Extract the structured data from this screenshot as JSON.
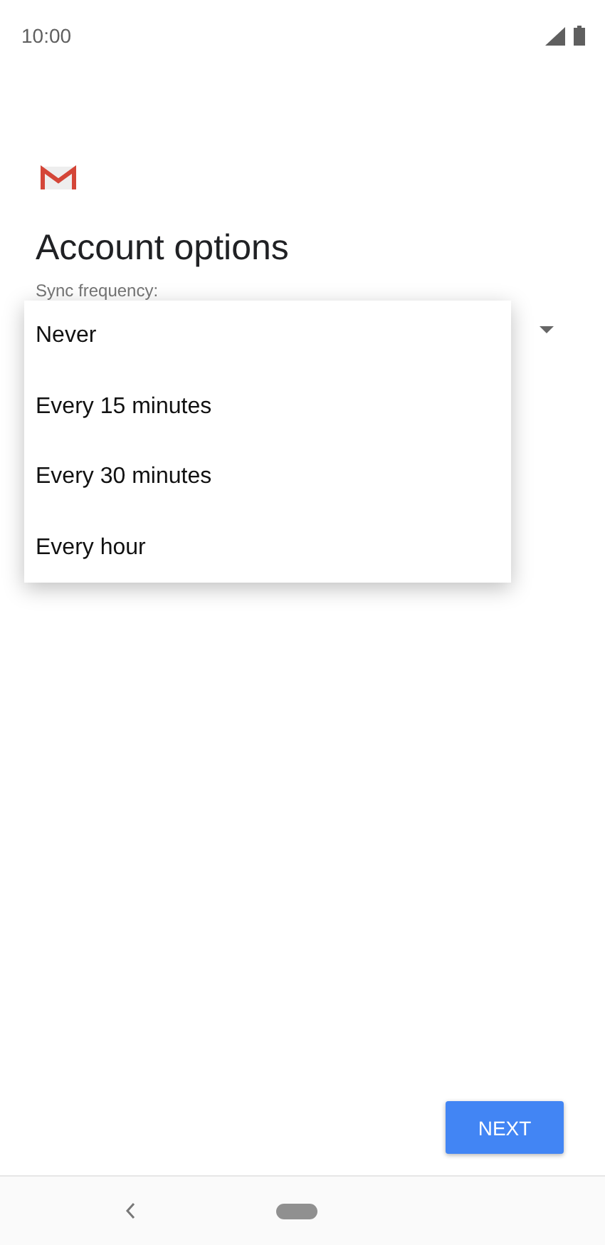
{
  "status_bar": {
    "time": "10:00"
  },
  "title": "Account options",
  "sync_frequency": {
    "label": "Sync frequency:",
    "menu_options": [
      {
        "label": "Never"
      },
      {
        "label": "Every 15 minutes"
      },
      {
        "label": "Every 30 minutes"
      },
      {
        "label": "Every hour"
      }
    ]
  },
  "buttons": [
    {
      "label": "NEXT"
    }
  ]
}
